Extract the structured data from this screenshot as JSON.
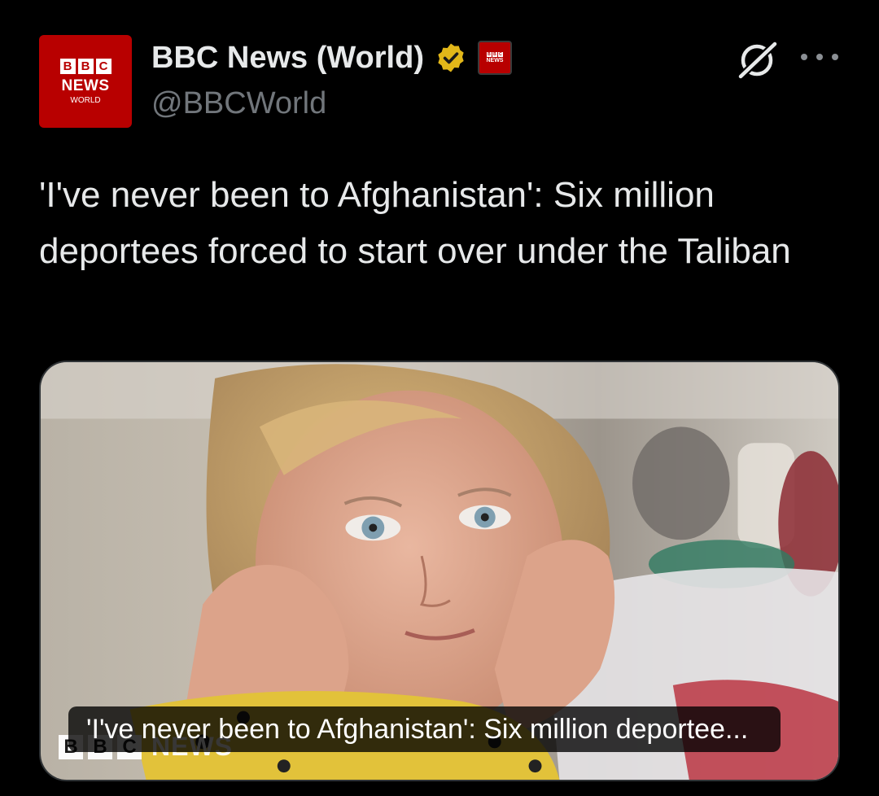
{
  "author": {
    "display_name": "BBC News (World)",
    "handle": "@BBCWorld",
    "avatar": {
      "blocks": [
        "B",
        "B",
        "C"
      ],
      "line1": "NEWS",
      "line2": "WORLD"
    },
    "verified_icon": "verified-badge-icon",
    "verified_color": "#e2b719",
    "affiliate_badge": {
      "blocks": [
        "B",
        "B",
        "C"
      ],
      "text": "NEWS"
    }
  },
  "actions": {
    "grok_icon": "grok-icon",
    "more_icon": "more-options-icon"
  },
  "post": {
    "text": "'I've never been to Afghanistan': Six million deportees forced to start over under the Taliban"
  },
  "card": {
    "title": "'I've never been to Afghanistan': Six million deportee...",
    "watermark": {
      "blocks": [
        "B",
        "B",
        "C"
      ],
      "text": "NEWS"
    },
    "image_subject": "child-photo"
  },
  "colors": {
    "background": "#000000",
    "text_primary": "#e7e9ea",
    "text_secondary": "#71767b",
    "bbc_red": "#b80000"
  }
}
